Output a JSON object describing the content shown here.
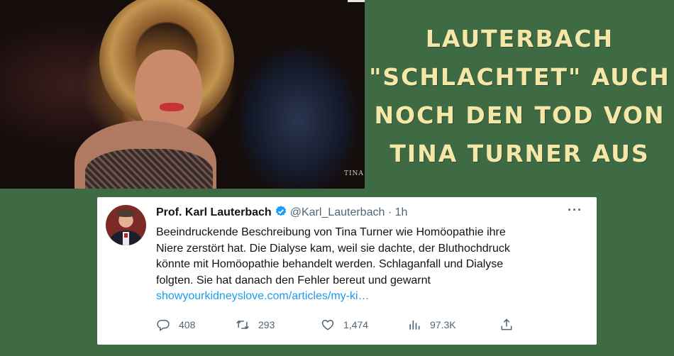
{
  "headline": {
    "lines": [
      "LAUTERBACH",
      "\"SCHLACHTET\" AUCH",
      "NOCH DEN TOD VON",
      "TINA TURNER AUS"
    ]
  },
  "photo": {
    "watermark": "TINA"
  },
  "tweet": {
    "author_name": "Prof. Karl Lauterbach",
    "handle": "@Karl_Lauterbach",
    "separator": "·",
    "time": "1h",
    "more_label": "···",
    "text_lines": [
      "Beeindruckende Beschreibung von Tina Turner wie Homöopathie ihre",
      "Niere zerstört hat. Die Dialyse kam, weil sie dachte, der Bluthochdruck",
      "könnte mit Homöopathie behandelt werden. Schlaganfall und Dialyse",
      "folgten. Sie hat danach den Fehler bereut und gewarnt"
    ],
    "link_text": "showyourkidneyslove.com/articles/my-ki…",
    "metrics": {
      "replies": "408",
      "retweets": "293",
      "likes": "1,474",
      "views": "97.3K"
    },
    "icons": {
      "verified": "verified-badge-icon",
      "reply": "reply-icon",
      "retweet": "retweet-icon",
      "like": "heart-icon",
      "views": "views-icon",
      "share": "share-icon"
    }
  },
  "colors": {
    "background": "#3f6b44",
    "headline": "#f5e7a8",
    "link": "#1d9bf0",
    "muted": "#536471"
  }
}
